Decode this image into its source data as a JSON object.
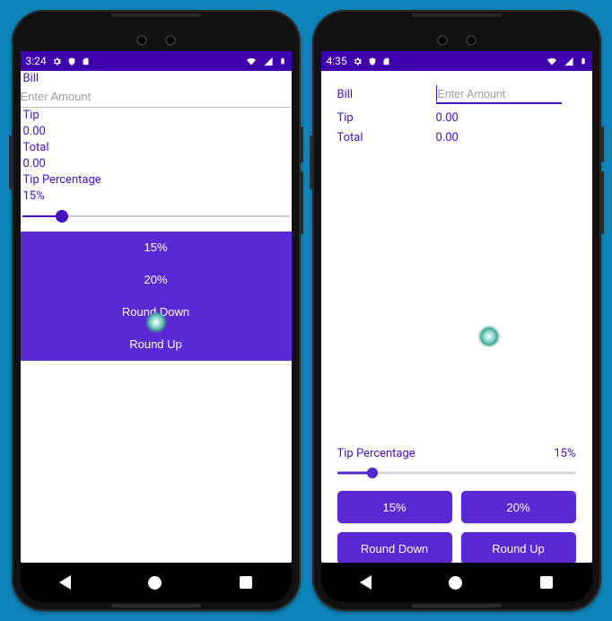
{
  "colors": {
    "accent": "#4611c0",
    "button": "#5b29d3",
    "statusbar": "#3f00ad"
  },
  "left": {
    "status_time": "3:24",
    "bill_label": "Bill",
    "bill_placeholder": "Enter Amount",
    "tip_label": "Tip",
    "tip_value": "0.00",
    "total_label": "Total",
    "total_value": "0.00",
    "percent_label": "Tip Percentage",
    "percent_value": "15%",
    "slider_fraction": 0.15,
    "buttons": [
      "15%",
      "20%",
      "Round Down",
      "Round Up"
    ],
    "touch_point_note": "ripple indicator centered near Round Up button"
  },
  "right": {
    "status_time": "4:35",
    "bill_label": "Bill",
    "bill_placeholder": "Enter Amount",
    "tip_label": "Tip",
    "tip_value": "0.00",
    "total_label": "Total",
    "total_value": "0.00",
    "percent_label": "Tip Percentage",
    "percent_value": "15%",
    "slider_fraction": 0.15,
    "buttons": [
      "15%",
      "20%",
      "Round Down",
      "Round Up"
    ],
    "touch_point_note": "ripple indicator roughly at screen center"
  }
}
